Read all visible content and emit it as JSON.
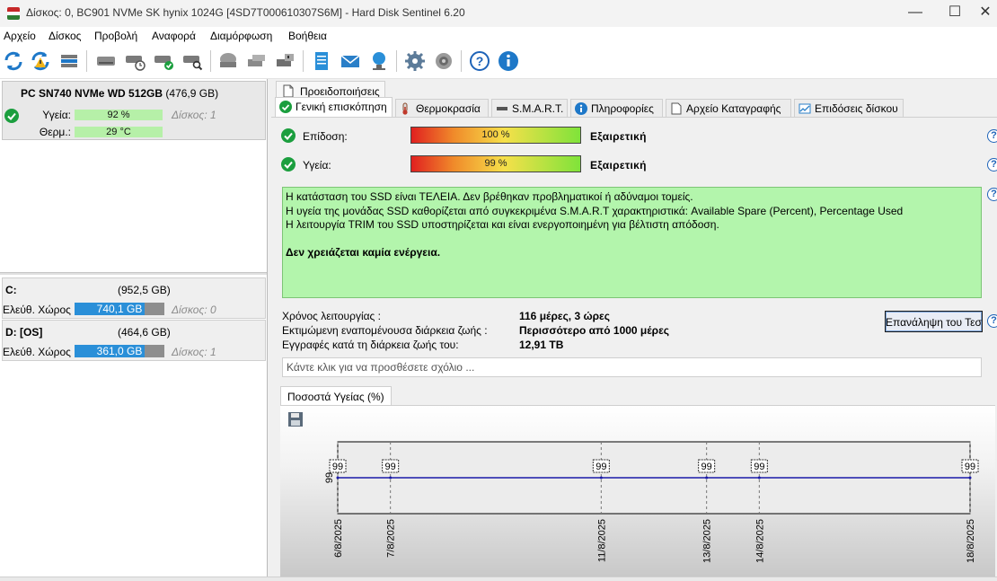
{
  "window": {
    "title": "Δίσκος: 0, BC901 NVMe SK hynix 1024G [4SD7T000610307S6M]  -  Hard Disk Sentinel 6.20",
    "minimize": "—",
    "maximize": "☐",
    "close": "✕"
  },
  "menu": [
    "Αρχείο",
    "Δίσκος",
    "Προβολή",
    "Αναφορά",
    "Διαμόρφωση",
    "Βοήθεια"
  ],
  "toolbar_icons": [
    "refresh-icon",
    "refresh-warning-icon",
    "disk-list-icon",
    "disk-icon",
    "disk-clock-icon",
    "disk-check-icon",
    "disk-search-icon",
    "disk-surface-icon",
    "disk-eject-icon",
    "disk-usb-icon",
    "report-icon",
    "mail-icon",
    "network-icon",
    "settings-icon",
    "speaker-icon",
    "help-icon",
    "info-icon"
  ],
  "disk_card": {
    "name": "PC SN740 NVMe WD 512GB",
    "size": "(476,9 GB)",
    "health_label": "Υγεία:",
    "health_value": "92 %",
    "disk_ref": "Δίσκος: 1",
    "temp_label": "Θερμ.:",
    "temp_value": "29 °C"
  },
  "volumes": [
    {
      "name": "C:",
      "size": "(952,5 GB)",
      "free_label": "Ελεύθ. Χώρος",
      "free_value": "740,1 GB",
      "free_fraction": 0.78,
      "disk_ref": "Δίσκος: 0"
    },
    {
      "name": "D: [OS]",
      "size": "(464,6 GB)",
      "free_label": "Ελεύθ. Χώρος",
      "free_value": "361,0 GB",
      "free_fraction": 0.78,
      "disk_ref": "Δίσκος: 1"
    }
  ],
  "alerts_tab": "Προειδοποιήσεις",
  "tabs": [
    "Γενική επισκόπηση",
    "Θερμοκρασία",
    "S.M.A.R.T.",
    "Πληροφορίες",
    "Αρχείο Καταγραφής",
    "Επιδόσεις δίσκου"
  ],
  "overview": {
    "performance_label": "Επίδοση:",
    "performance_value": "100 %",
    "performance_fraction": 1.0,
    "performance_verdict": "Εξαιρετική",
    "health_label": "Υγεία:",
    "health_value": "99 %",
    "health_fraction": 0.99,
    "health_verdict": "Εξαιρετική",
    "help": "?",
    "status_lines": [
      "Η κατάσταση του SSD είναι ΤΕΛΕΙΑ. Δεν βρέθηκαν προβληματικοί ή αδύναμοι τομείς.",
      "Η υγεία  της μονάδας SSD καθορίζεται από συγκεκριμένα S.M.A.R.T χαρακτηριστικά: Available Spare (Percent), Percentage Used",
      "Η λειτουργία TRIM του SSD υποστηρίζεται και είναι ενεργοποιημένη για βέλτιστη απόδοση."
    ],
    "status_action": "Δεν χρειάζεται καμία ενέργεια.",
    "power_on_label": "Χρόνος λειτουργίας :",
    "power_on_value": "116 μέρες, 3 ώρες",
    "lifetime_label": "Εκτιμώμενη εναπομένουσα διάρκεια ζωής :",
    "lifetime_value": "Περισσότερο από 1000 μέρες",
    "writes_label": "Εγγραφές κατά τη διάρκεια ζωής του:",
    "writes_value": "12,91 TB",
    "retest_button": "Επανάληψη του Τεσ",
    "comment_placeholder": "Κάντε κλικ για να προσθέσετε σχόλιο ..."
  },
  "chart_tab": "Ποσοστά Υγείας (%)",
  "chart_data": {
    "type": "line",
    "x": [
      "6/8/2025",
      "7/8/2025",
      "11/8/2025",
      "13/8/2025",
      "14/8/2025",
      "18/8/2025"
    ],
    "values": [
      99,
      99,
      99,
      99,
      99,
      99
    ],
    "ytick": "99",
    "color": "#1a1aa8"
  }
}
